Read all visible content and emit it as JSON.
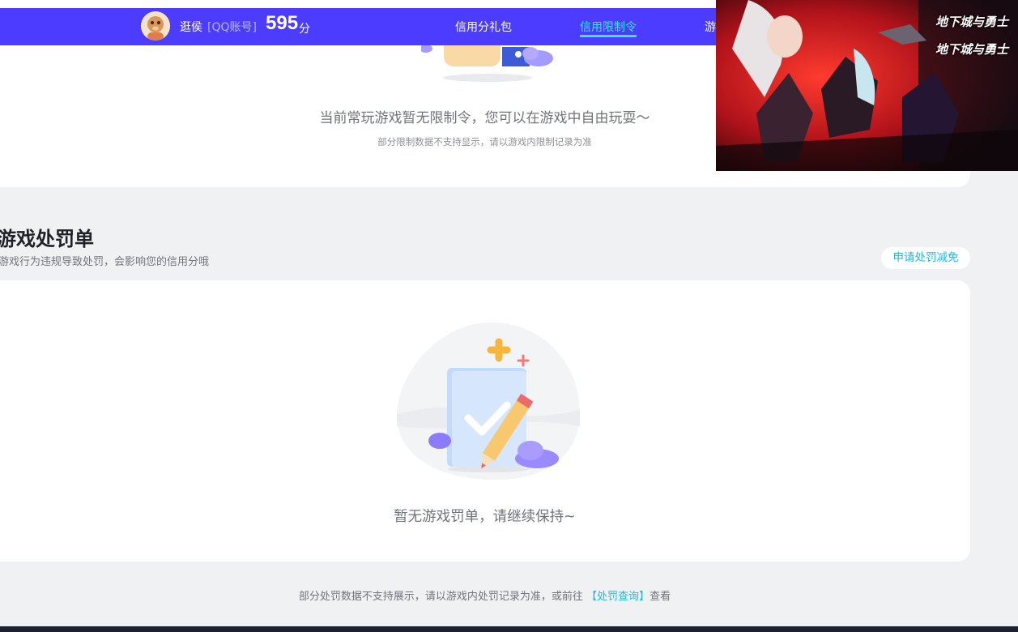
{
  "header": {
    "user_name": "逛侯",
    "account_type": "[QQ账号]",
    "score": "595",
    "score_unit": "分",
    "tabs": [
      {
        "label": "信用分礼包",
        "active": false
      },
      {
        "label": "信用限制令",
        "active": true
      },
      {
        "label": "游",
        "active": false
      }
    ],
    "brand_color": "#4c3cff",
    "active_color": "#3ee3ff"
  },
  "restriction_card": {
    "empty_text": "当前常玩游戏暂无限制令，您可以在游戏中自由玩耍～",
    "note": "部分限制数据不支持显示，请以游戏内限制记录为准"
  },
  "penalty_section": {
    "title": "游戏处罚单",
    "subtitle": "游戏行为违规导致处罚，会影响您的信用分哦",
    "appeal_button": "申请处罚减免",
    "empty_text": "暂无游戏罚单，请继续保持~"
  },
  "footer": {
    "note_before": "部分处罚数据不支持展示，请以游戏内处罚记录为准，或前往 ",
    "link_text": "【处罚查询】",
    "note_after": "查看"
  },
  "ad": {
    "logo_text_1": "地下城与勇士",
    "logo_text_2": "地下城与勇士"
  }
}
